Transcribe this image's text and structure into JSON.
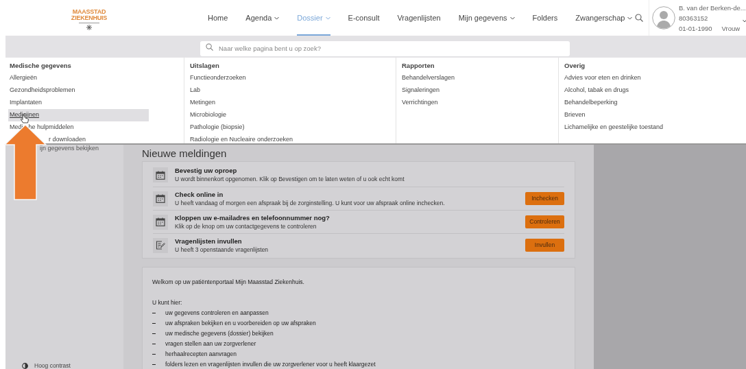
{
  "logo": {
    "lines": [
      "MAASSTAD",
      "ZIEKENHUIS"
    ]
  },
  "nav": [
    {
      "label": "Home",
      "dropdown": false,
      "selected": false
    },
    {
      "label": "Agenda",
      "dropdown": true,
      "selected": false
    },
    {
      "label": "Dossier",
      "dropdown": true,
      "selected": true
    },
    {
      "label": "E-consult",
      "dropdown": false,
      "selected": false
    },
    {
      "label": "Vragenlijsten",
      "dropdown": false,
      "selected": false
    },
    {
      "label": "Mijn gegevens",
      "dropdown": true,
      "selected": false
    },
    {
      "label": "Folders",
      "dropdown": false,
      "selected": false
    },
    {
      "label": "Zwangerschap",
      "dropdown": true,
      "selected": false
    }
  ],
  "user": {
    "name": "B. van der Berken-de...",
    "number": "80363152",
    "birthdate": "01-01-1990",
    "gender": "Vrouw"
  },
  "search": {
    "placeholder": "Naar welke pagina bent u op zoek?"
  },
  "menu_columns": [
    {
      "heading": "Medische gegevens",
      "items": [
        {
          "label": "Allergieën",
          "selected": false
        },
        {
          "label": "Gezondheidsproblemen",
          "selected": false
        },
        {
          "label": "Implantaten",
          "selected": false
        },
        {
          "label": "Medicijnen",
          "selected": true
        },
        {
          "label_parts": [
            "Medi",
            "he hulpmiddelen"
          ],
          "selected": false,
          "partly_hidden": true
        },
        {
          "label_parts": [
            "r downloaden"
          ],
          "selected": false,
          "partly_hidden": true
        }
      ]
    },
    {
      "heading": "Uitslagen",
      "items": [
        {
          "label": "Functieonderzoeken",
          "selected": false
        },
        {
          "label": "Lab",
          "selected": false
        },
        {
          "label": "Metingen",
          "selected": false
        },
        {
          "label": "Microbiologie",
          "selected": false
        },
        {
          "label": "Pathologie (biopsie)",
          "selected": false
        },
        {
          "label": "Radiologie en Nucleaire onderzoeken",
          "selected": false
        }
      ]
    },
    {
      "heading": "Rapporten",
      "items": [
        {
          "label": "Behandelverslagen",
          "selected": false
        },
        {
          "label": "Signaleringen",
          "selected": false
        },
        {
          "label": "Verrichtingen",
          "selected": false
        }
      ]
    },
    {
      "heading": "Overig",
      "items": [
        {
          "label": "Advies voor eten en drinken",
          "selected": false
        },
        {
          "label": "Alcohol, tabak en drugs",
          "selected": false
        },
        {
          "label": "Behandelbeperking",
          "selected": false
        },
        {
          "label": "Brieven",
          "selected": false
        },
        {
          "label": "Lichamelijke en geestelijke toestand",
          "selected": false
        }
      ]
    }
  ],
  "sidebar": {
    "items": [
      "ijn gegevens bekijken"
    ],
    "footer": "Hoog contrast"
  },
  "notifications": {
    "title": "Nieuwe meldingen",
    "items": [
      {
        "kind": "calendar",
        "title": "Bevestig uw oproep",
        "text": "U wordt binnenkort opgenomen. Klik op Bevestigen om te laten weten of u ook echt komt"
      },
      {
        "kind": "calendar",
        "title": "Check online in",
        "text": "U heeft vandaag of morgen een afspraak bij de zorginstelling. U kunt voor uw afspraak online inchecken.",
        "button": "Inchecken"
      },
      {
        "kind": "calendar",
        "title": "Kloppen uw e-mailadres en telefoonnummer nog?",
        "text": "Klik op de knop om uw contactgegevens te controleren",
        "button": "Controleren"
      },
      {
        "kind": "form",
        "title": "Vragenlijsten invullen",
        "text": "U heeft 3 openstaande vragenlijsten",
        "button": "Invullen"
      }
    ]
  },
  "welcome": {
    "intro": "Welkom op uw patiëntenportaal Mijn Maasstad Ziekenhuis.",
    "lead": "U kunt hier:",
    "bullets": [
      "uw gegevens controleren en aanpassen",
      "uw afspraken bekijken en u voorbereiden op uw afspraken",
      "uw medische gegevens (dossier) bekijken",
      "vragen stellen aan uw zorgverlener",
      "herhaalrecepten aanvragen",
      "folders lezen en vragenlijsten invullen die uw zorgverlener voor u heeft klaargezet"
    ]
  }
}
